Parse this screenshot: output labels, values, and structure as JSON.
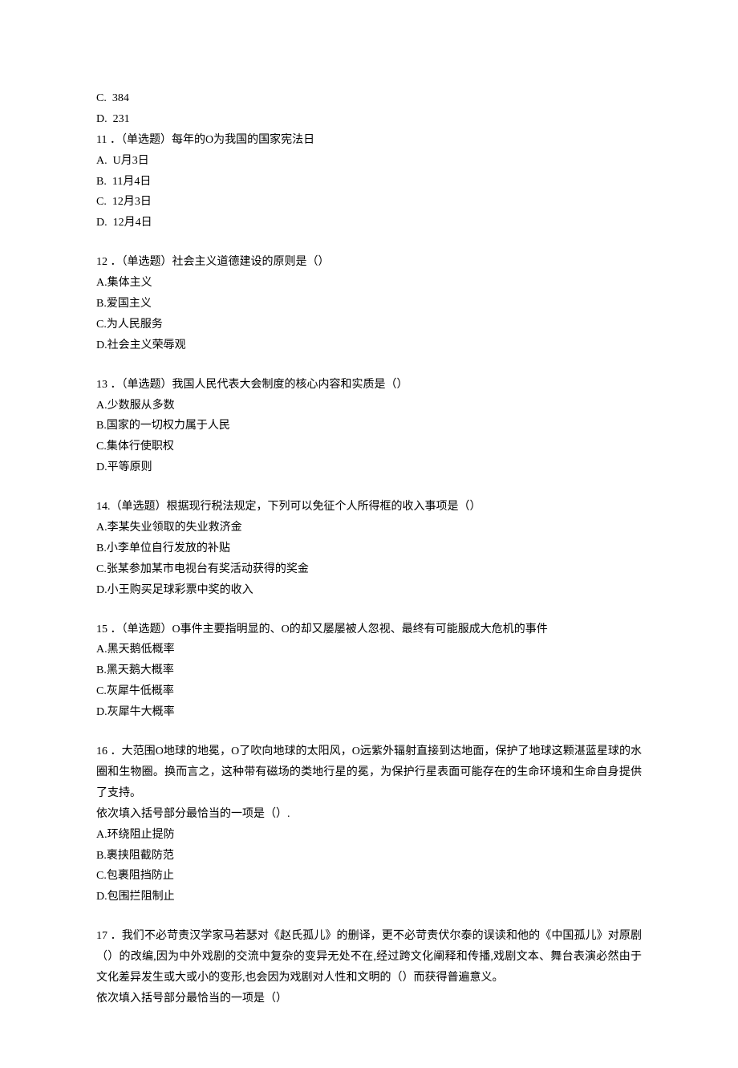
{
  "q10_tail": {
    "options": [
      {
        "label": "C.",
        "text": "384"
      },
      {
        "label": "D.",
        "text": "231"
      }
    ]
  },
  "q11": {
    "stem": "11 ．（单选题）每年的O为我国的国家宪法日",
    "options": [
      {
        "label": "A.",
        "text": "U月3日"
      },
      {
        "label": "B.",
        "text": "11月4日"
      },
      {
        "label": "C.",
        "text": "12月3日"
      },
      {
        "label": "D.",
        "text": "12月4日"
      }
    ]
  },
  "q12": {
    "stem": "12 ．（单选题）社会主义道德建设的原则是（）",
    "options": [
      {
        "label": "A.",
        "text": "集体主义"
      },
      {
        "label": "B.",
        "text": "爱国主义"
      },
      {
        "label": "C.",
        "text": "为人民服务"
      },
      {
        "label": "D.",
        "text": "社会主义荣辱观"
      }
    ]
  },
  "q13": {
    "stem": "13 ．（单选题）我国人民代表大会制度的核心内容和实质是（）",
    "options": [
      {
        "label": "A.",
        "text": "少数服从多数"
      },
      {
        "label": "B.",
        "text": "国家的一切权力属于人民"
      },
      {
        "label": "C.",
        "text": "集体行使职权"
      },
      {
        "label": "D.",
        "text": "平等原则"
      }
    ]
  },
  "q14": {
    "stem": "14.（单选题）根据现行税法规定，下列可以免征个人所得框的收入事项是（）",
    "options": [
      {
        "label": "A.",
        "text": "李某失业领取的失业救济金"
      },
      {
        "label": "B.",
        "text": "小李单位自行发放的补贴"
      },
      {
        "label": "C.",
        "text": "张某参加某市电视台有奖活动获得的奖金"
      },
      {
        "label": "D.",
        "text": "小王购买足球彩票中奖的收入"
      }
    ]
  },
  "q15": {
    "stem": "15 ．（单选题）O事件主要指明显的、O的却又屡屡被人忽视、最终有可能服成大危机的事件",
    "options": [
      {
        "label": "A.",
        "text": "黑天鹅低概率"
      },
      {
        "label": "B.",
        "text": "黑天鹅大概率"
      },
      {
        "label": "C.",
        "text": "灰犀牛低概率"
      },
      {
        "label": "D.",
        "text": "灰犀牛大概率"
      }
    ]
  },
  "q16": {
    "stem_lines": [
      "16 ．大范围O地球的地冕，O了吹向地球的太阳风，O远紫外辐射直接到达地面，保护了地球这颗湛蓝星球的水圈和生物圈。换而言之，这种带有磁场的类地行星的冕，为保护行星表面可能存在的生命环境和生命自身提供了支持。",
      "依次填入括号部分最恰当的一项是（）."
    ],
    "options": [
      {
        "label": "A.",
        "text": "环绕阻止提防"
      },
      {
        "label": "B.",
        "text": "裹挟阻截防范"
      },
      {
        "label": "C.",
        "text": "包裹阻挡防止"
      },
      {
        "label": "D.",
        "text": "包围拦阻制止"
      }
    ]
  },
  "q17": {
    "stem_lines": [
      "17 ．我们不必苛责汉学家马若瑟对《赵氏孤儿》的删译，更不必苛责伏尔泰的误读和他的《中国孤儿》对原剧（）的改编,因为中外戏剧的交流中复杂的变异无处不在,经过跨文化阐释和传播,戏剧文本、舞台表演必然由于文化差异发生或大或小的变形,也会因为戏剧对人性和文明的（）而获得普遍意义。",
      "依次填入括号部分最恰当的一项是（）"
    ]
  }
}
